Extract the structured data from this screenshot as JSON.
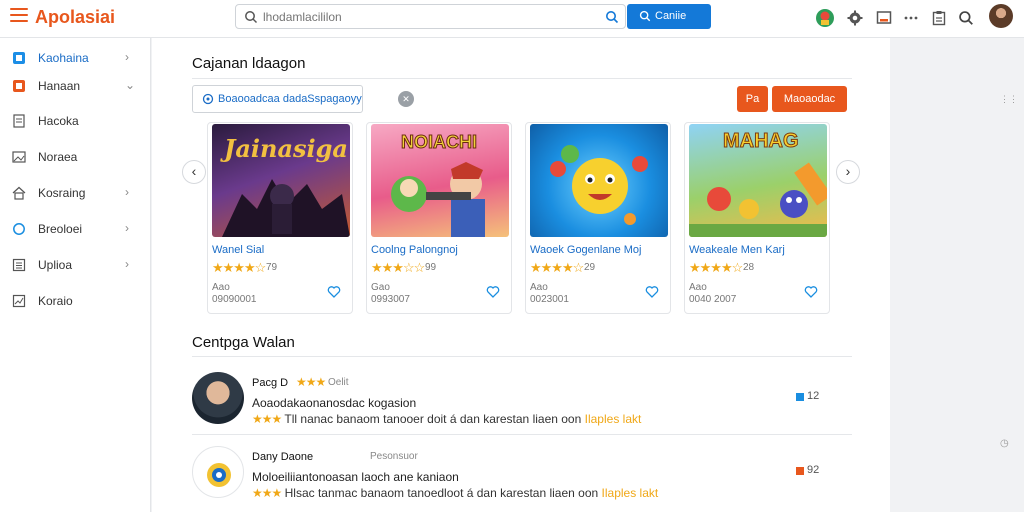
{
  "app": {
    "brand": "Apolasiai"
  },
  "search": {
    "placeholder": "lhodamlacililon",
    "button_label": "Caniie"
  },
  "sidebar": {
    "items": [
      {
        "label": "Kaohaina",
        "icon": "square-blue-icon",
        "chevron": "›"
      },
      {
        "label": "Hanaan",
        "icon": "square-orange-icon",
        "chevron": "⌄"
      },
      {
        "label": "Hacoka",
        "icon": "document-icon",
        "chevron": ""
      },
      {
        "label": "Noraea",
        "icon": "image-icon",
        "chevron": ""
      },
      {
        "label": "Kosraing",
        "icon": "home-icon",
        "chevron": "›"
      },
      {
        "label": "Breoloei",
        "icon": "circle-icon",
        "chevron": "›"
      },
      {
        "label": "Uplioa",
        "icon": "list-icon",
        "chevron": "›"
      },
      {
        "label": "Koraio",
        "icon": "chart-icon",
        "chevron": ""
      }
    ]
  },
  "section1": {
    "title": "Cajanan ldaagon",
    "filter_text": "Boaooadcaa dadaSspagaoyy",
    "btn_small": "Pa",
    "btn_large": "Maoaodac"
  },
  "cards": [
    {
      "art_title": "Jainasiga",
      "title": "Wanel Sial",
      "count": "79",
      "meta1": "Aao",
      "meta2": "09090001",
      "accent": "#6a3a8c"
    },
    {
      "art_title": "NOIACHI",
      "title": "Coolng Palongnoj",
      "count": "99",
      "meta1": "Gao",
      "meta2": "0993007",
      "accent": "#d94f8a"
    },
    {
      "art_title": "",
      "title": "Waoek Gogenlane Moj",
      "count": "29",
      "meta1": "Aao",
      "meta2": "0023001",
      "accent": "#1a8ee0"
    },
    {
      "art_title": "MAHAG",
      "title": "Weakeale Men Karj",
      "count": "28",
      "meta1": "Aao",
      "meta2": "0040 2007",
      "accent": "#f39a2d"
    }
  ],
  "section2": {
    "title": "Centpga Walan"
  },
  "reviews": [
    {
      "name": "Pacg D",
      "badge": "Oelit",
      "line1": "Aoaodakaonanosdac kogasion",
      "line2_text": "Tll nanac banaom tanooer doit á dan karestan liaen oon",
      "line2_tag": "Ilaples lakt",
      "count": "12"
    },
    {
      "name": "Dany Daone",
      "badge": "Pesonsuor",
      "line1": "Moloeiliiantonoasan laoch ane kaniaon",
      "line2_text": "Hlsac tanmac banaom tanoedloot á dan karestan liaen oon",
      "line2_tag": "Ilaples lakt",
      "count": "92"
    }
  ],
  "colors": {
    "accent": "#e8571d",
    "link": "#1a6cc6",
    "primary": "#1479d8",
    "star": "#f0a818"
  }
}
